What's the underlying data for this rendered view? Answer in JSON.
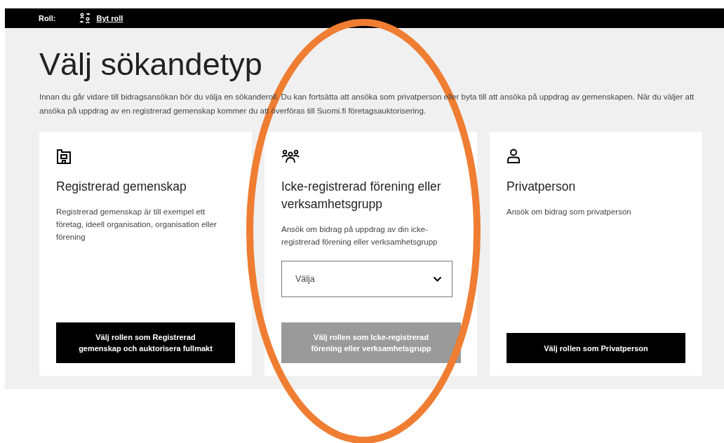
{
  "top_bar": {
    "role_label": "Roll:",
    "switch_link": "Byt roll"
  },
  "title": "Välj sökandetyp",
  "intro": "Innan du går vidare till bidragsansökan bör du välja en sökanderoll. Du kan fortsätta att ansöka som privatperson eller byta till att ansöka på uppdrag av gemenskapen. När du väljer att ansöka på uppdrag av en registrerad gemenskap kommer du att överföras till Suomi.fi företagsauktorisering.",
  "cards": [
    {
      "kind": "building",
      "title": "Registrerad gemenskap",
      "description": "Registrerad gemenskap är till exempel ett företag, ideell organisation, organisation eller förening",
      "button": {
        "label": "Välj rollen som Registrerad gemenskap och auktorisera fullmakt",
        "disabled": false
      }
    },
    {
      "kind": "group",
      "title": "Icke-registrerad förening eller verksamhetsgrupp",
      "description": "Ansök om bidrag på uppdrag av din icke-registrerad förening eller verksamhetsgrupp",
      "select": {
        "placeholder": "Välja"
      },
      "button": {
        "label": "Välj rollen som Icke-registrerad förening eller verksamhetsgrupp",
        "disabled": true
      }
    },
    {
      "kind": "person",
      "title": "Privatperson",
      "description": "Ansök om bidrag som privatperson",
      "button": {
        "label": "Välj rollen som Privatperson",
        "disabled": false
      }
    }
  ],
  "annotation": {
    "kind": "ellipse"
  }
}
